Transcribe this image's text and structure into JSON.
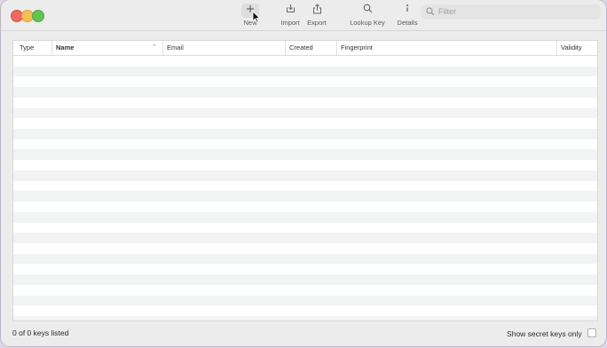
{
  "toolbar": {
    "new_label": "New",
    "import_label": "Import",
    "export_label": "Export",
    "lookup_label": "Lookup Key",
    "details_label": "Details",
    "filter_placeholder": "Filter",
    "icons": {
      "new": "plus-icon",
      "import": "import-tray-icon",
      "export": "share-icon",
      "lookup": "magnifier-icon",
      "details": "info-icon",
      "filter": "search-icon"
    }
  },
  "table": {
    "columns": {
      "type": "Type",
      "name": "Name",
      "email": "Email",
      "created": "Created",
      "fingerprint": "Fingerprint",
      "validity": "Validity"
    },
    "sorted_by": "Name",
    "sort_direction": "ascending",
    "rows": []
  },
  "footer": {
    "status": "0 of 0 keys listed",
    "secret_toggle_label": "Show secret keys only",
    "secret_toggle_checked": false
  },
  "colors": {
    "close": "#ee6a5f",
    "minimize": "#f5bf4f",
    "maximize": "#61c554",
    "row_alt": "#f2f3f3"
  }
}
